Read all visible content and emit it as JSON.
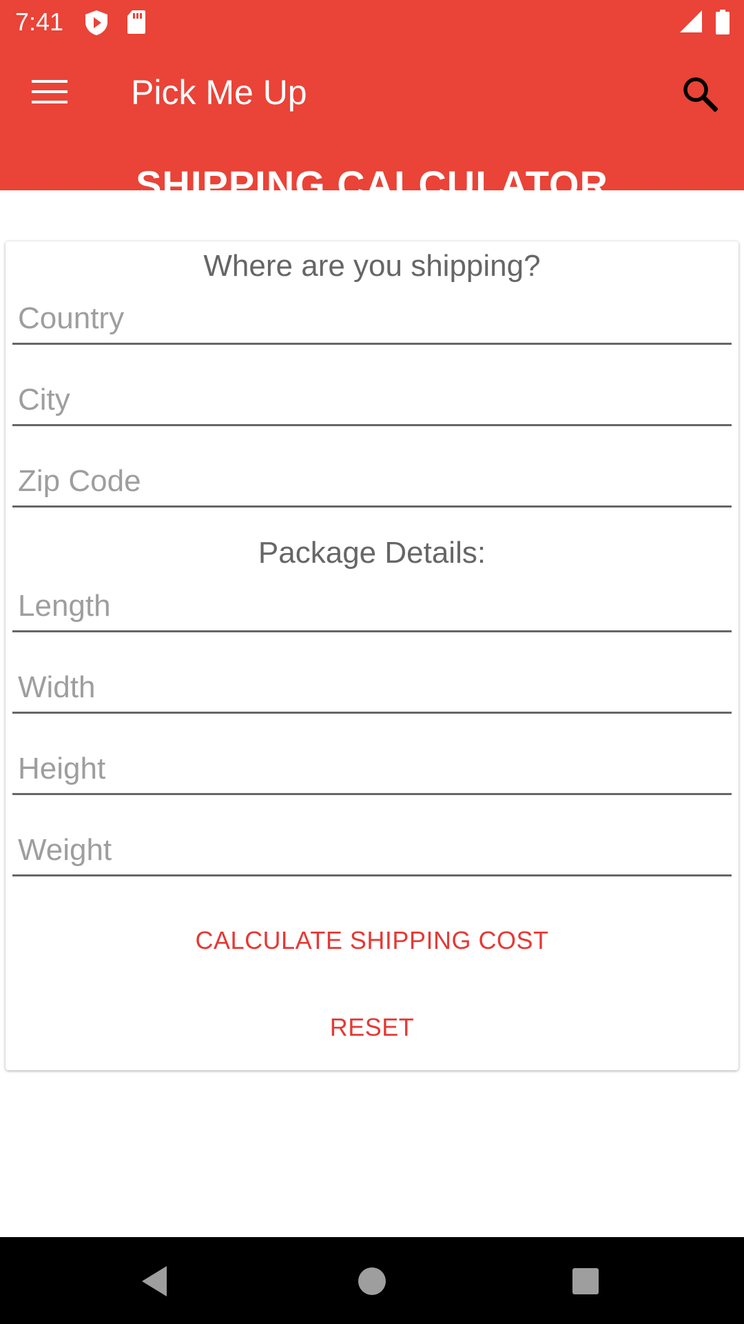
{
  "status_bar": {
    "time": "7:41",
    "icons": [
      "shield-play-icon",
      "sd-card-icon",
      "signal-icon",
      "battery-icon"
    ]
  },
  "app_bar": {
    "title": "Pick Me Up",
    "heading": "SHIPPING CALCULATOR",
    "menu_icon": "hamburger-menu-icon",
    "search_icon": "search-icon",
    "color": "#EA4337"
  },
  "form": {
    "destination_label": "Where are you shipping?",
    "country_placeholder": "Country",
    "city_placeholder": "City",
    "zip_placeholder": "Zip Code",
    "package_label": "Package Details:",
    "length_placeholder": "Length",
    "width_placeholder": "Width",
    "height_placeholder": "Height",
    "weight_placeholder": "Weight",
    "calculate_label": "CALCULATE SHIPPING COST",
    "reset_label": "RESET",
    "button_color": "#E53935"
  },
  "nav_bar": {
    "icons": [
      "back-icon",
      "home-icon",
      "recents-icon"
    ]
  }
}
